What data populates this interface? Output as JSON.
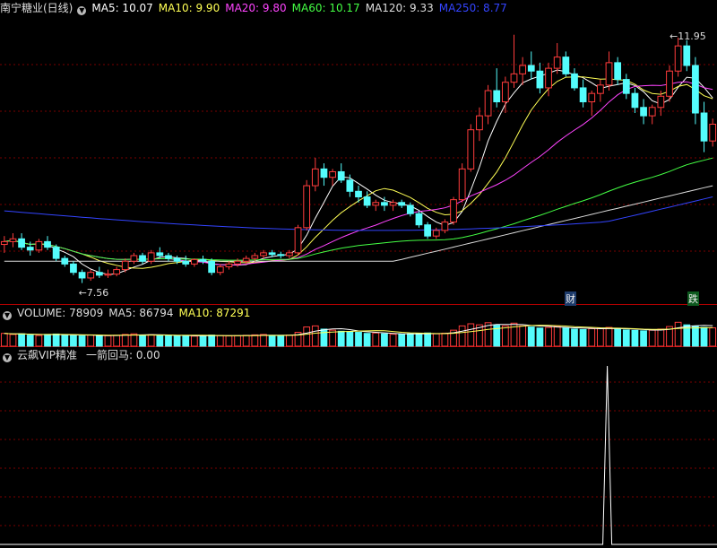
{
  "main_header": {
    "stock_title": "南宁糖业(日线)",
    "ma_labels": [
      {
        "text": "MA5: 10.07",
        "color": "#ffffff"
      },
      {
        "text": "MA10: 9.90",
        "color": "#ffff55"
      },
      {
        "text": "MA20: 9.80",
        "color": "#ff44ff"
      },
      {
        "text": "MA60: 10.17",
        "color": "#44ff44"
      },
      {
        "text": "MA120: 9.33",
        "color": "#dddddd"
      },
      {
        "text": "MA250: 8.77",
        "color": "#3344ff"
      }
    ]
  },
  "volume_header": {
    "labels": [
      {
        "text": "VOLUME: 78909",
        "color": "#dddddd"
      },
      {
        "text": "MA5: 86794",
        "color": "#dddddd"
      },
      {
        "text": "MA10: 87291",
        "color": "#ffff55"
      }
    ]
  },
  "indicator_header": {
    "title": "云飙VIP精准",
    "value_label": "一箭回马: 0.00"
  },
  "annotations": {
    "low_label": "7.56",
    "high_label": "11.95",
    "cai_tag": "财",
    "die_tag": "跌"
  },
  "colors": {
    "up": "#ff3c3c",
    "down": "#54fcfc",
    "grid": "#7a0000",
    "border": "#b00000"
  },
  "chart_data": {
    "type": "candlestick",
    "price_low_label": 7.56,
    "price_high_label": 11.95,
    "candles_ohlc": [
      [
        8.25,
        8.4,
        8.1,
        8.3
      ],
      [
        8.3,
        8.45,
        8.2,
        8.35
      ],
      [
        8.35,
        8.45,
        8.15,
        8.2
      ],
      [
        8.2,
        8.3,
        8.05,
        8.15
      ],
      [
        8.15,
        8.35,
        8.1,
        8.3
      ],
      [
        8.3,
        8.4,
        8.15,
        8.2
      ],
      [
        8.2,
        8.25,
        7.95,
        8.0
      ],
      [
        8.0,
        8.05,
        7.85,
        7.9
      ],
      [
        7.9,
        7.95,
        7.7,
        7.75
      ],
      [
        7.75,
        7.8,
        7.56,
        7.65
      ],
      [
        7.65,
        7.8,
        7.6,
        7.75
      ],
      [
        7.75,
        7.85,
        7.65,
        7.7
      ],
      [
        7.7,
        7.8,
        7.65,
        7.72
      ],
      [
        7.72,
        7.85,
        7.68,
        7.8
      ],
      [
        7.8,
        8.0,
        7.75,
        7.95
      ],
      [
        7.95,
        8.1,
        7.9,
        8.05
      ],
      [
        8.05,
        8.1,
        7.9,
        7.95
      ],
      [
        7.95,
        8.15,
        7.9,
        8.1
      ],
      [
        8.1,
        8.2,
        8.0,
        8.05
      ],
      [
        8.05,
        8.1,
        7.95,
        8.0
      ],
      [
        8.0,
        8.05,
        7.9,
        7.95
      ],
      [
        7.95,
        8.05,
        7.85,
        7.9
      ],
      [
        7.9,
        8.0,
        7.85,
        7.98
      ],
      [
        7.98,
        8.05,
        7.9,
        7.95
      ],
      [
        7.95,
        8.0,
        7.7,
        7.75
      ],
      [
        7.75,
        7.9,
        7.7,
        7.85
      ],
      [
        7.85,
        7.95,
        7.8,
        7.9
      ],
      [
        7.9,
        8.0,
        7.85,
        7.95
      ],
      [
        7.95,
        8.05,
        7.9,
        8.0
      ],
      [
        8.0,
        8.1,
        7.95,
        8.05
      ],
      [
        8.05,
        8.15,
        8.0,
        8.1
      ],
      [
        8.1,
        8.15,
        8.02,
        8.07
      ],
      [
        8.07,
        8.12,
        8.0,
        8.05
      ],
      [
        8.05,
        8.15,
        8.0,
        8.1
      ],
      [
        8.1,
        8.6,
        8.05,
        8.55
      ],
      [
        8.55,
        9.4,
        8.5,
        9.3
      ],
      [
        9.3,
        9.8,
        9.2,
        9.6
      ],
      [
        9.6,
        9.7,
        9.3,
        9.45
      ],
      [
        9.45,
        9.6,
        9.3,
        9.55
      ],
      [
        9.55,
        9.7,
        9.35,
        9.4
      ],
      [
        9.4,
        9.5,
        9.1,
        9.2
      ],
      [
        9.2,
        9.3,
        9.0,
        9.1
      ],
      [
        9.1,
        9.2,
        8.9,
        8.95
      ],
      [
        8.95,
        9.05,
        8.85,
        9.0
      ],
      [
        9.0,
        9.1,
        8.85,
        8.95
      ],
      [
        8.95,
        9.05,
        8.85,
        9.0
      ],
      [
        9.0,
        9.05,
        8.9,
        8.95
      ],
      [
        8.95,
        9.0,
        8.75,
        8.8
      ],
      [
        8.8,
        8.85,
        8.55,
        8.6
      ],
      [
        8.6,
        8.65,
        8.35,
        8.4
      ],
      [
        8.4,
        8.55,
        8.35,
        8.5
      ],
      [
        8.5,
        8.7,
        8.45,
        8.65
      ],
      [
        8.65,
        9.1,
        8.6,
        9.05
      ],
      [
        9.05,
        9.7,
        9.0,
        9.6
      ],
      [
        9.6,
        10.4,
        9.55,
        10.3
      ],
      [
        10.3,
        10.7,
        10.1,
        10.55
      ],
      [
        10.55,
        11.1,
        10.4,
        11.0
      ],
      [
        11.0,
        11.4,
        10.7,
        10.8
      ],
      [
        10.8,
        11.25,
        10.6,
        11.15
      ],
      [
        11.15,
        12.0,
        11.05,
        11.3
      ],
      [
        11.3,
        11.6,
        11.1,
        11.45
      ],
      [
        11.45,
        11.7,
        11.2,
        11.35
      ],
      [
        11.35,
        11.5,
        10.95,
        11.05
      ],
      [
        11.05,
        11.5,
        10.9,
        11.4
      ],
      [
        11.4,
        11.85,
        11.3,
        11.6
      ],
      [
        11.6,
        11.7,
        11.25,
        11.3
      ],
      [
        11.3,
        11.4,
        11.0,
        11.05
      ],
      [
        11.05,
        11.2,
        10.7,
        10.8
      ],
      [
        10.8,
        11.0,
        10.55,
        10.95
      ],
      [
        10.95,
        11.2,
        10.8,
        11.1
      ],
      [
        11.1,
        11.7,
        11.0,
        11.5
      ],
      [
        11.5,
        11.6,
        11.1,
        11.2
      ],
      [
        11.2,
        11.3,
        10.85,
        10.95
      ],
      [
        10.95,
        11.05,
        10.6,
        10.7
      ],
      [
        10.7,
        10.85,
        10.4,
        10.55
      ],
      [
        10.55,
        10.75,
        10.4,
        10.7
      ],
      [
        10.7,
        11.0,
        10.55,
        10.9
      ],
      [
        10.9,
        11.45,
        10.8,
        11.35
      ],
      [
        11.35,
        11.95,
        11.25,
        11.8
      ],
      [
        11.8,
        11.9,
        11.35,
        11.45
      ],
      [
        11.45,
        11.6,
        10.4,
        10.6
      ],
      [
        10.6,
        10.8,
        9.9,
        10.1
      ],
      [
        10.1,
        10.5,
        10.0,
        10.4
      ]
    ],
    "volume": [
      60,
      55,
      58,
      52,
      50,
      55,
      57,
      53,
      50,
      48,
      52,
      50,
      49,
      51,
      55,
      58,
      52,
      54,
      50,
      49,
      48,
      50,
      47,
      49,
      52,
      50,
      48,
      49,
      51,
      53,
      55,
      50,
      49,
      52,
      65,
      90,
      95,
      80,
      75,
      70,
      68,
      65,
      60,
      62,
      58,
      56,
      55,
      58,
      60,
      62,
      58,
      61,
      75,
      95,
      105,
      100,
      110,
      98,
      95,
      108,
      95,
      90,
      85,
      88,
      92,
      86,
      80,
      78,
      82,
      84,
      88,
      80,
      76,
      74,
      72,
      75,
      80,
      92,
      112,
      100,
      95,
      88,
      86
    ],
    "ma250_label_value": 8.77,
    "indicator_peak_index": 70,
    "indicator_value": 0.0
  }
}
